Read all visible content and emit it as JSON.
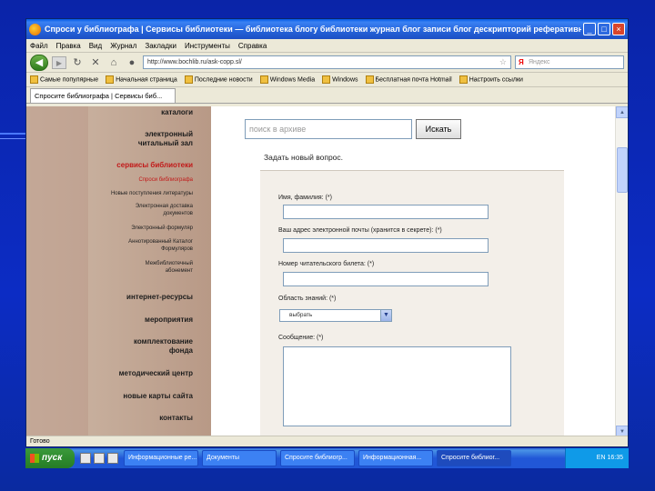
{
  "window": {
    "title": "Спроси у библиографа | Сервисы библиотеки — библиотека блогу библиотеки журнал блог записи блог дескрипторий реферативный журна...",
    "controls": [
      "_",
      "□",
      "×"
    ]
  },
  "menubar": {
    "items": [
      "Файл",
      "Правка",
      "Вид",
      "Журнал",
      "Закладки",
      "Инструменты",
      "Справка"
    ]
  },
  "navbar": {
    "url": "http://www.bochlib.ru/ask-copp.sl/",
    "search_placeholder": "Яндекс",
    "search_engine": "Я"
  },
  "bookmarks": {
    "items": [
      "Самые популярные",
      "Начальная страница",
      "Последние новости",
      "Windows Media",
      "Windows",
      "Бесплатная почта Hotmail",
      "Настроить ссылки"
    ]
  },
  "tab": {
    "label": "Спросите библиографа | Сервисы биб..."
  },
  "sidebar": {
    "items": [
      {
        "label": "каталоги",
        "active": false
      },
      {
        "label": "электронный\nчитальный зал",
        "active": false
      },
      {
        "label": "сервисы библиотеки",
        "active": true
      },
      {
        "label": "интернет-ресурсы",
        "active": false
      },
      {
        "label": "мероприятия",
        "active": false
      },
      {
        "label": "комплектование\nфонда",
        "active": false
      },
      {
        "label": "методический центр",
        "active": false
      },
      {
        "label": "новые карты сайта",
        "active": false
      },
      {
        "label": "контакты",
        "active": false
      }
    ],
    "subitems": [
      {
        "label": "Спроси библиографа",
        "active": true
      },
      {
        "label": "Новые поступления литературы",
        "active": false
      },
      {
        "label": "Электронная доставка\nдокументов",
        "active": false
      },
      {
        "label": "Электронный формуляр",
        "active": false
      },
      {
        "label": "Аннотированный Каталог\nФормуляров",
        "active": false
      },
      {
        "label": "Межбиблиотечный\nабонемент",
        "active": false
      }
    ]
  },
  "main": {
    "search_placeholder": "поиск в архиве",
    "search_button": "Искать",
    "form_title": "Задать новый вопрос.",
    "fields": {
      "name_label": "Имя, фамилия: (*)",
      "email_label": "Ваш адрес электронной почты (хранится в секрете): (*)",
      "phone_label": "Номер читательского билета: (*)",
      "area_label": "Область знаний: (*)",
      "area_value": "выбрать",
      "message_label": "Сообщение: (*)"
    }
  },
  "statusbar": {
    "text": "Готово"
  },
  "taskbar": {
    "start_label": "пуск",
    "tasks": [
      {
        "label": "Информационные ре...",
        "active": false
      },
      {
        "label": "Документы",
        "active": false
      },
      {
        "label": "Спросите библиогр...",
        "active": false
      },
      {
        "label": "Информационная...",
        "active": false
      },
      {
        "label": "Спросите библиог...",
        "active": true
      }
    ],
    "time": "16:35",
    "lang": "EN"
  }
}
